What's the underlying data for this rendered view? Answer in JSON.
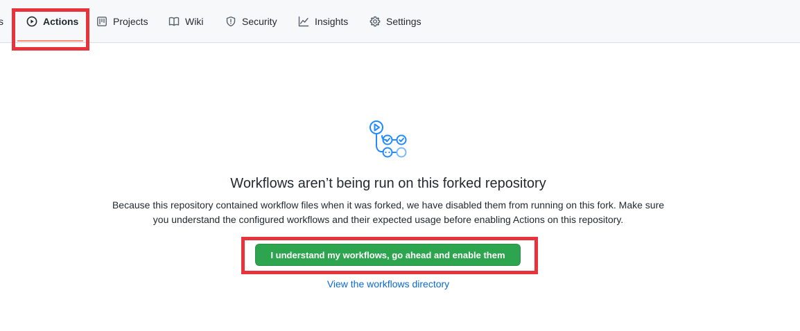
{
  "nav": {
    "partial_label": "s",
    "tabs": [
      {
        "label": "Actions",
        "icon": "play-icon",
        "active": true
      },
      {
        "label": "Projects",
        "icon": "project-board-icon"
      },
      {
        "label": "Wiki",
        "icon": "book-icon"
      },
      {
        "label": "Security",
        "icon": "shield-icon"
      },
      {
        "label": "Insights",
        "icon": "graph-icon"
      },
      {
        "label": "Settings",
        "icon": "gear-icon"
      }
    ]
  },
  "main": {
    "title": "Workflows aren’t being run on this forked repository",
    "description": "Because this repository contained workflow files when it was forked, we have disabled them from running on this fork. Make sure you understand the configured workflows and their expected usage before enabling Actions on this repository.",
    "enable_button": "I understand my workflows, go ahead and enable them",
    "directory_link": "View the workflows directory"
  },
  "colors": {
    "primary_button": "#2da44e",
    "link": "#0969da",
    "highlight": "#e8323c",
    "illustration": "#218bff"
  }
}
